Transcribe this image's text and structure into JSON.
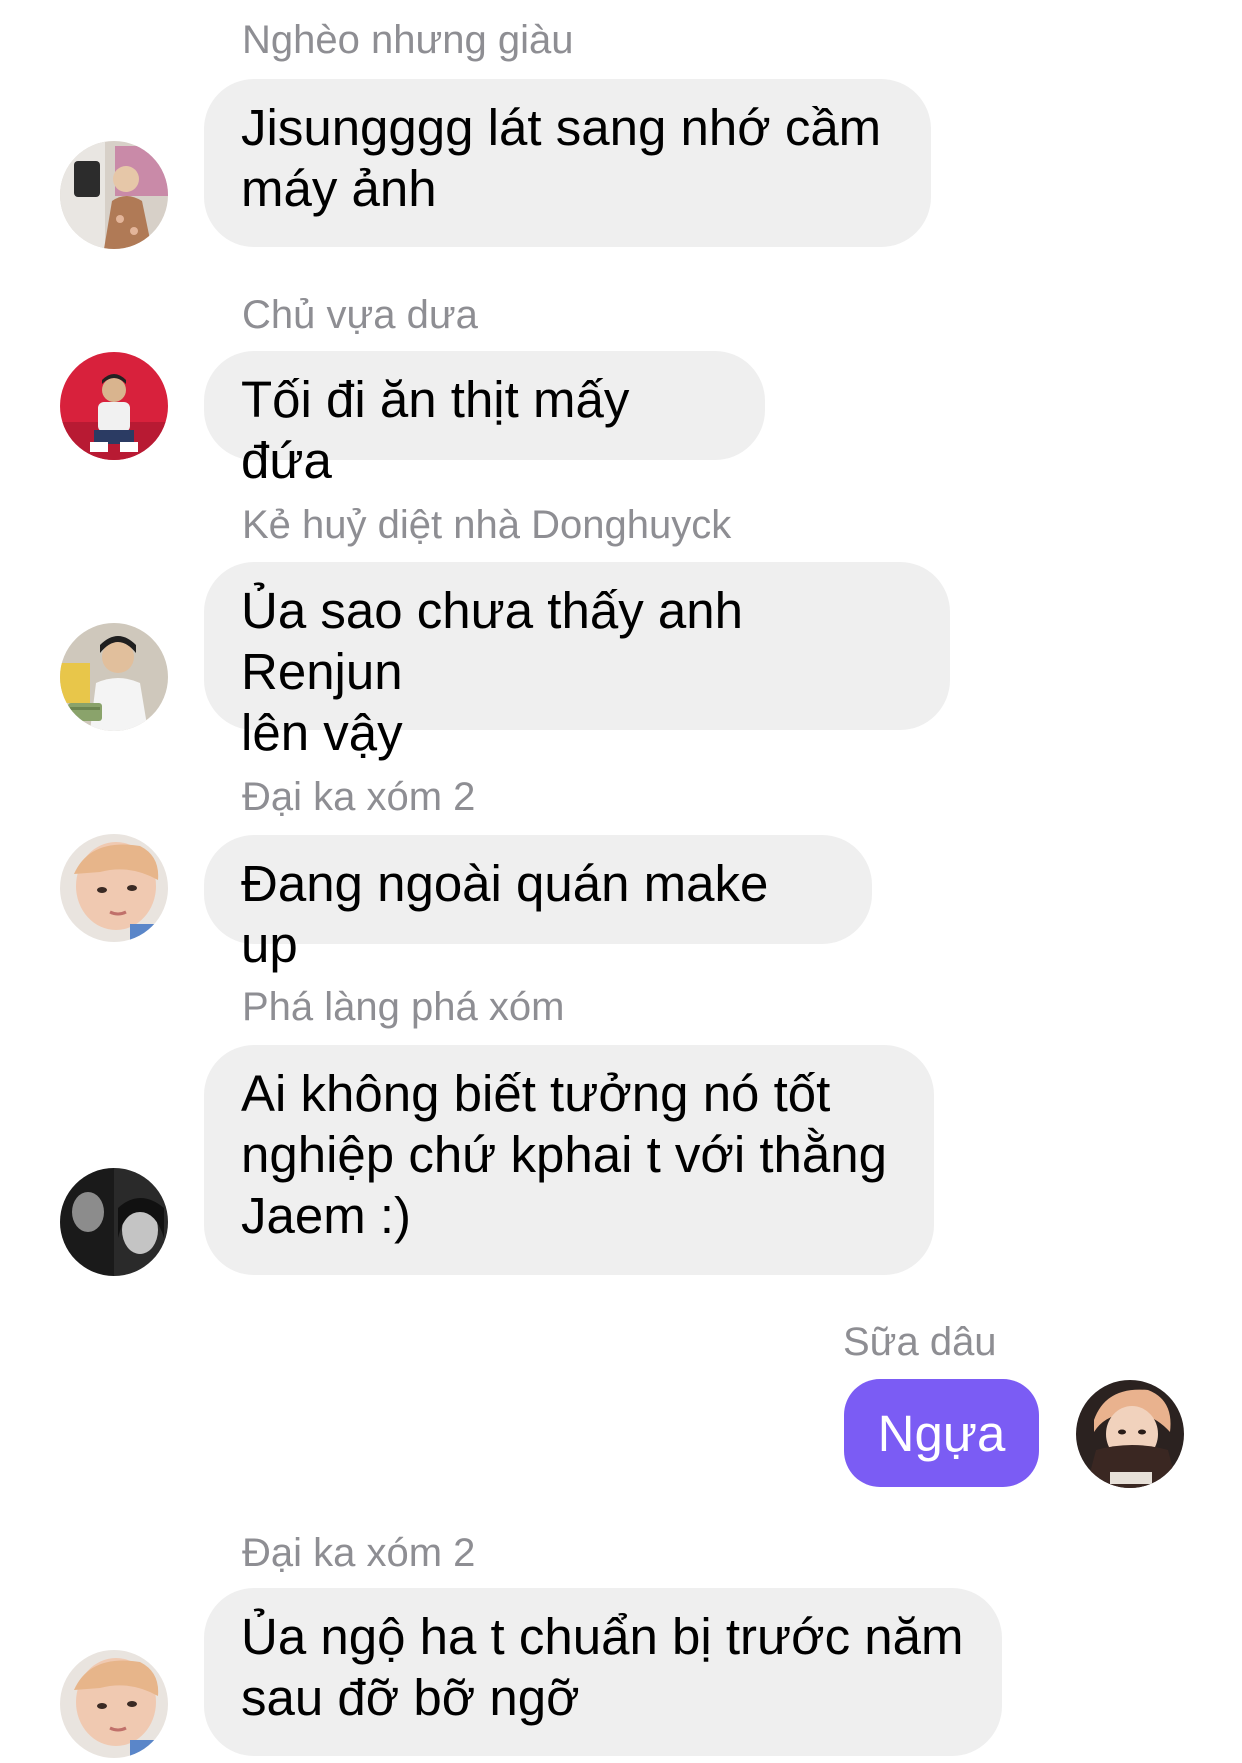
{
  "conversation": {
    "messages": [
      {
        "sender": "Nghèo nhưng giàu",
        "text": "Jisungggg lát sang nhớ cầm\nmáy ảnh"
      },
      {
        "sender": "Chủ vựa dưa",
        "text": "Tối đi ăn thịt mấy đứa"
      },
      {
        "sender": "Kẻ huỷ diệt nhà Donghuyck",
        "text": "Ủa sao chưa thấy anh Renjun\nlên vậy"
      },
      {
        "sender": "Đại ka xóm 2",
        "text": "Đang ngoài quán make up"
      },
      {
        "sender": "Phá làng phá xóm",
        "text": "Ai không biết tưởng nó tốt\nnghiệp chứ kphai t với thằng\nJaem :)"
      },
      {
        "sender": "Sữa dâu",
        "text": "Ngựa"
      },
      {
        "sender": "Đại ka xóm 2",
        "text": "Ủa ngộ ha t chuẩn bị trước năm\nsau đỡ bỡ ngỡ"
      }
    ]
  },
  "colors": {
    "incoming_bubble": "#efefef",
    "outgoing_bubble": "#7b5cf4",
    "sender_name": "#8e8e93"
  }
}
